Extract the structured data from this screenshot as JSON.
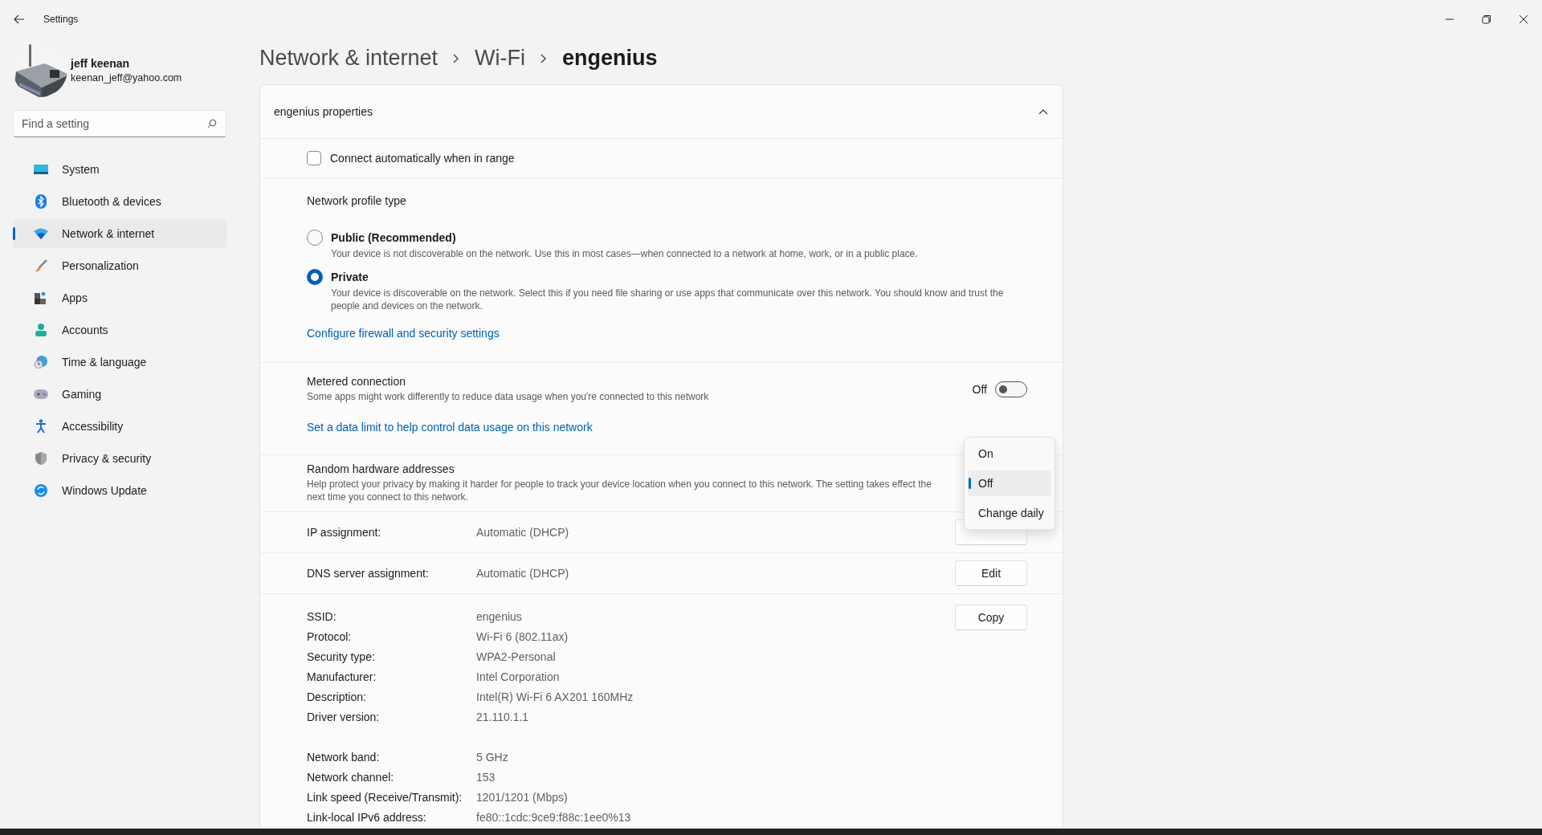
{
  "window": {
    "title": "Settings"
  },
  "account": {
    "name": "jeff keenan",
    "email": "keenan_jeff@yahoo.com"
  },
  "search": {
    "placeholder": "Find a setting"
  },
  "nav": [
    {
      "label": "System",
      "kind": "system",
      "selected": false
    },
    {
      "label": "Bluetooth & devices",
      "kind": "bluetooth",
      "selected": false
    },
    {
      "label": "Network & internet",
      "kind": "network",
      "selected": true
    },
    {
      "label": "Personalization",
      "kind": "brush",
      "selected": false
    },
    {
      "label": "Apps",
      "kind": "apps",
      "selected": false
    },
    {
      "label": "Accounts",
      "kind": "person",
      "selected": false
    },
    {
      "label": "Time & language",
      "kind": "globe",
      "selected": false
    },
    {
      "label": "Gaming",
      "kind": "gamepad",
      "selected": false
    },
    {
      "label": "Accessibility",
      "kind": "accessibility",
      "selected": false
    },
    {
      "label": "Privacy & security",
      "kind": "shield",
      "selected": false
    },
    {
      "label": "Windows Update",
      "kind": "update",
      "selected": false
    }
  ],
  "breadcrumb": [
    "Network & internet",
    "Wi-Fi",
    "engenius"
  ],
  "properties": {
    "title": "engenius properties",
    "expanded": true,
    "connect_auto": {
      "label": "Connect automatically when in range",
      "checked": false
    },
    "profile": {
      "heading": "Network profile type",
      "options": [
        {
          "label": "Public (Recommended)",
          "description": "Your device is not discoverable on the network. Use this in most cases—when connected to a network at home, work, or in a public place.",
          "selected": false
        },
        {
          "label": "Private",
          "description": "Your device is discoverable on the network. Select this if you need file sharing or use apps that communicate over this network. You should know and trust the people and devices on the network.",
          "selected": true
        }
      ],
      "link": "Configure firewall and security settings"
    },
    "metered": {
      "title": "Metered connection",
      "description": "Some apps might work differently to reduce data usage when you're connected to this network",
      "state_label": "Off",
      "on": false,
      "link": "Set a data limit to help control data usage on this network"
    },
    "random_hw": {
      "title": "Random hardware addresses",
      "description": "Help protect your privacy by making it harder for people to track your device location when you connect to this network. The setting takes effect the next time you connect to this network.",
      "options": [
        {
          "label": "On",
          "selected": false
        },
        {
          "label": "Off",
          "selected": true
        },
        {
          "label": "Change daily",
          "selected": false
        }
      ]
    },
    "assignments": [
      {
        "label": "IP assignment:",
        "value": "Automatic (DHCP)",
        "edit_button": true
      },
      {
        "label": "DNS server assignment:",
        "value": "Automatic (DHCP)",
        "edit_button": true,
        "button": "Edit"
      }
    ],
    "details": {
      "button": "Copy",
      "groups": [
        [
          {
            "label": "SSID:",
            "value": "engenius"
          },
          {
            "label": "Protocol:",
            "value": "Wi-Fi 6 (802.11ax)"
          },
          {
            "label": "Security type:",
            "value": "WPA2-Personal"
          },
          {
            "label": "Manufacturer:",
            "value": "Intel Corporation"
          },
          {
            "label": "Description:",
            "value": "Intel(R) Wi-Fi 6 AX201 160MHz"
          },
          {
            "label": "Driver version:",
            "value": "21.110.1.1"
          }
        ],
        [
          {
            "label": "Network band:",
            "value": "5 GHz"
          },
          {
            "label": "Network channel:",
            "value": "153"
          },
          {
            "label": "Link speed (Receive/Transmit):",
            "value": "1201/1201 (Mbps)"
          },
          {
            "label": "Link-local IPv6 address:",
            "value": "fe80::1cdc:9ce9:f88c:1ee0%13"
          }
        ]
      ]
    }
  }
}
